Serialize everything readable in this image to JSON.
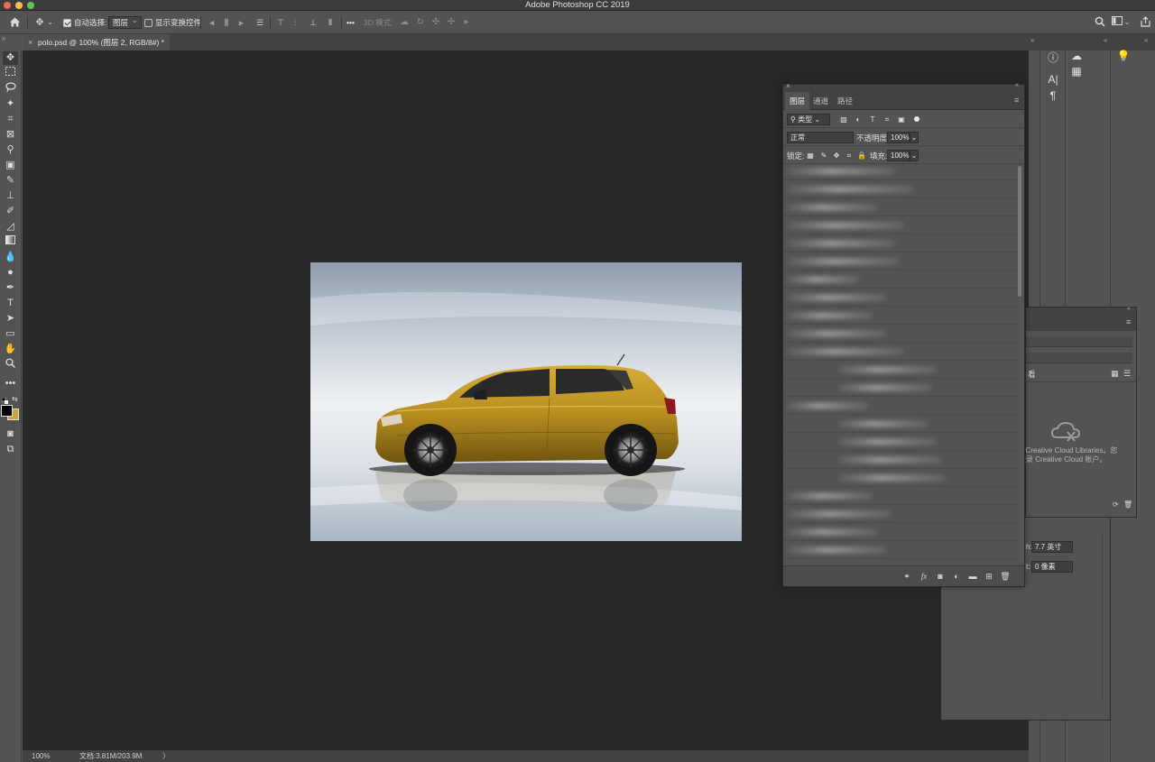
{
  "window": {
    "title": "Adobe Photoshop CC 2019"
  },
  "options_bar": {
    "auto_select_label": "自动选择:",
    "auto_select_target": "图层",
    "show_transform_label": "显示变换控件",
    "mode_3d_label": "3D 模式:",
    "more_label": "•••"
  },
  "document": {
    "tab_label": "polo.psd @ 100% (图层 2, RGB/8#) *",
    "close_glyph": "×"
  },
  "status": {
    "zoom": "100%",
    "doc_size": "文档:3.81M/203.9M",
    "arrow": "〉"
  },
  "layers_panel": {
    "tabs": [
      "图层",
      "通道",
      "路径"
    ],
    "filter_kind": "类型",
    "blend_mode": "正常",
    "opacity_label": "不透明度:",
    "opacity_value": "100%",
    "lock_label": "锁定:",
    "fill_label": "填充:",
    "fill_value": "100%"
  },
  "libraries_panel": {
    "view_label": "看",
    "message_line1": "E Creative Cloud Libraries。您",
    "message_line2": "登录 Creative Cloud 帐户。"
  },
  "properties_panel": {
    "width_label": "h:",
    "width_value": "7.7 英寸",
    "offset_label": "t:",
    "offset_value": "0 像素"
  },
  "colors": {
    "foreground": "#000000",
    "background": "#c9a53a",
    "car_body": "#b8901f"
  }
}
